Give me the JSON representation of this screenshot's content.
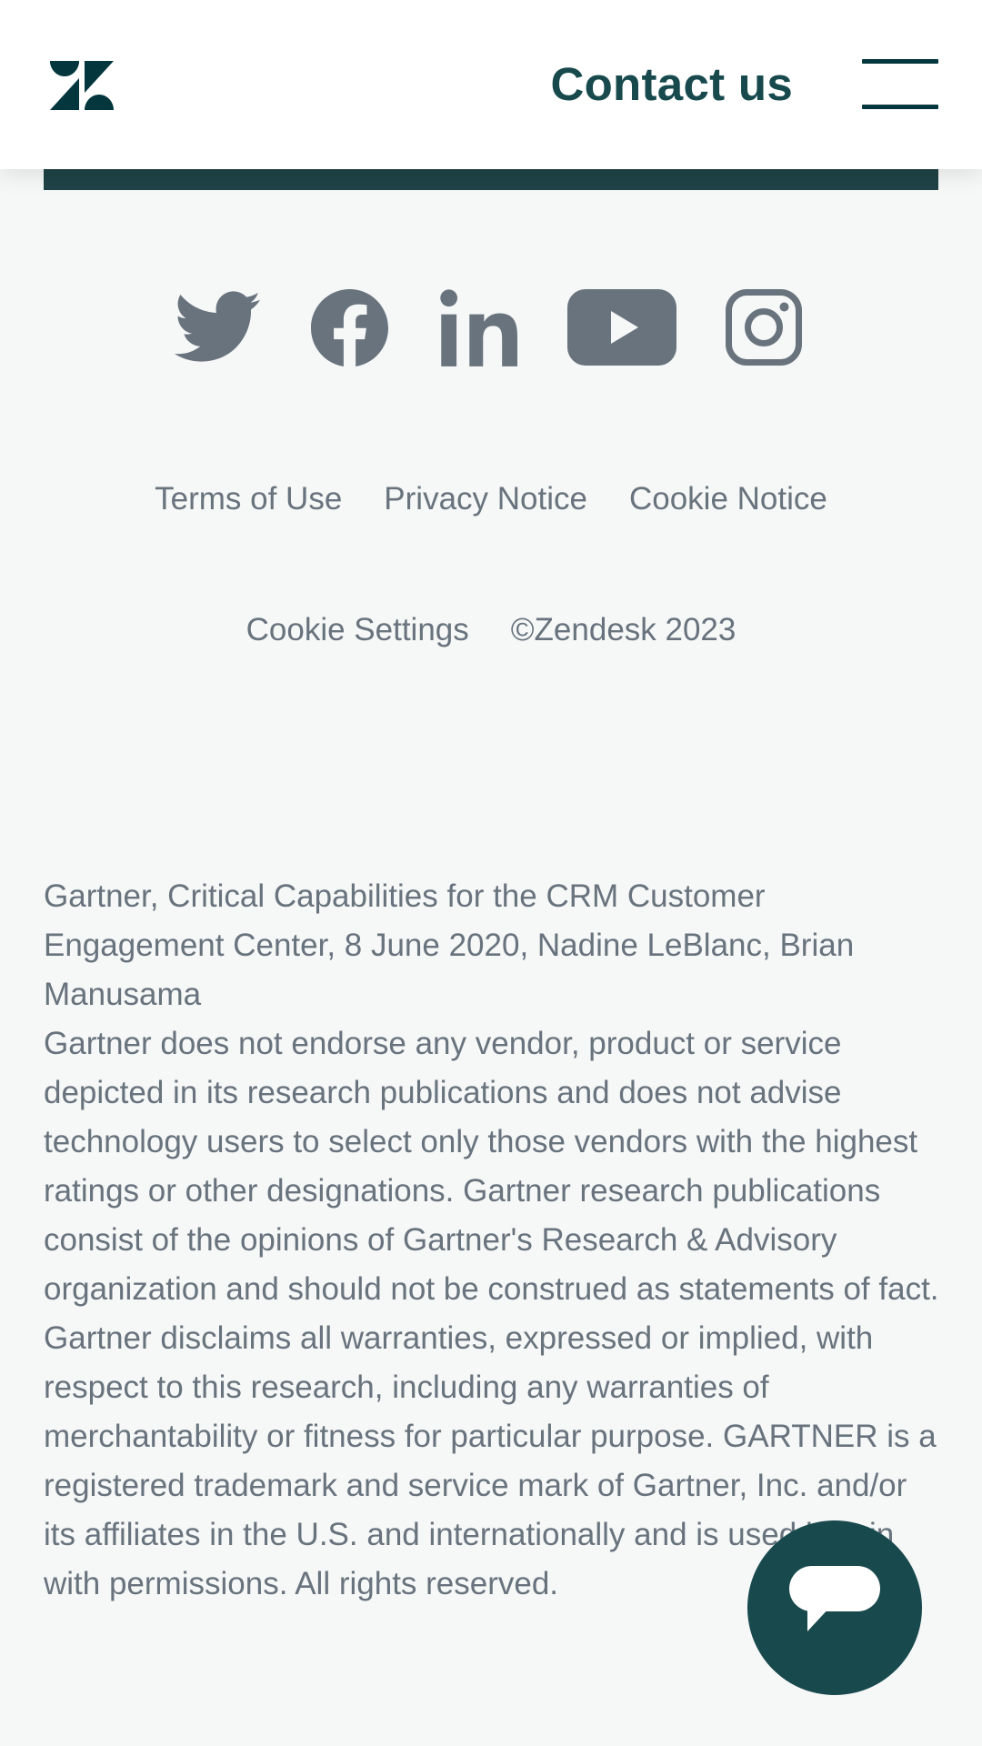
{
  "header": {
    "logo_icon": "zendesk-logo-icon",
    "contact_label": "Contact us",
    "menu_icon": "hamburger-menu-icon"
  },
  "social": [
    {
      "name": "twitter",
      "icon": "twitter-icon"
    },
    {
      "name": "facebook",
      "icon": "facebook-icon"
    },
    {
      "name": "linkedin",
      "icon": "linkedin-icon"
    },
    {
      "name": "youtube",
      "icon": "youtube-icon"
    },
    {
      "name": "instagram",
      "icon": "instagram-icon"
    }
  ],
  "footer": {
    "terms": "Terms of Use",
    "privacy": "Privacy Notice",
    "cookie_notice": "Cookie Notice",
    "cookie_settings": "Cookie Settings",
    "copyright": "©Zendesk 2023"
  },
  "disclaimer": {
    "citation": "Gartner, Critical Capabilities for the CRM Customer Engagement Center, 8 June 2020, Nadine LeBlanc, Brian Manusama",
    "body": "Gartner does not endorse any vendor, product or service depicted in its research publications and does not advise technology users to select only those vendors with the highest ratings or other designations. Gartner research publications consist of the opinions of Gartner's Research & Advisory organization and should not be construed as statements of fact. Gartner disclaims all warranties, expressed or implied, with respect to this research, including any warranties of merchantability or fitness for particular purpose. GARTNER is a registered trademark and service mark of Gartner, Inc. and/or its affiliates in the U.S. and internationally and is used herein with permissions. All rights reserved."
  },
  "chat": {
    "icon": "chat-bubble-icon"
  },
  "colors": {
    "brand_dark": "#17494d",
    "logo": "#03363d",
    "strip": "#1f4346",
    "footer_text": "#68737d",
    "icon_gray": "#68737d",
    "page_bg": "#f6f7f7"
  }
}
